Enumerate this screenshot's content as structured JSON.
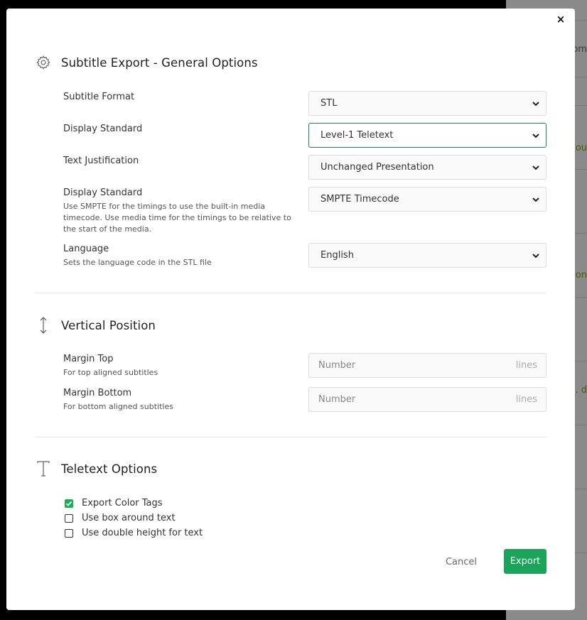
{
  "background": {
    "fragments": [
      "om",
      "you",
      "son",
      ". d"
    ]
  },
  "modal": {
    "close_label": "×"
  },
  "general": {
    "title": "Subtitle Export - General Options",
    "icon": "gear-icon",
    "subtitle_format": {
      "label": "Subtitle Format",
      "value": "STL"
    },
    "display_standard": {
      "label": "Display Standard",
      "value": "Level-1 Teletext"
    },
    "text_justification": {
      "label": "Text Justification",
      "value": "Unchanged Presentation"
    },
    "timecode": {
      "label": "Display Standard",
      "hint": "Use SMPTE for the timings to use the built-in media timecode. Use media time for the timings to be relative to the start of the media.",
      "value": "SMPTE Timecode"
    },
    "language": {
      "label": "Language",
      "hint": "Sets the language code in the STL file",
      "value": "English"
    }
  },
  "vertical": {
    "title": "Vertical Position",
    "icon": "vertical-arrows-icon",
    "margin_top": {
      "label": "Margin Top",
      "hint": "For top aligned subtitles",
      "placeholder": "Number",
      "unit": "lines"
    },
    "margin_bottom": {
      "label": "Margin Bottom",
      "hint": "For bottom aligned subtitles",
      "placeholder": "Number",
      "unit": "lines"
    }
  },
  "teletext": {
    "title": "Teletext Options",
    "icon": "text-t-icon",
    "options": [
      {
        "label": "Export Color Tags",
        "checked": true
      },
      {
        "label": "Use box around text",
        "checked": false
      },
      {
        "label": "Use double height for text",
        "checked": false
      }
    ]
  },
  "actions": {
    "cancel": "Cancel",
    "export": "Export"
  },
  "colors": {
    "accent": "#1aa45a",
    "checkbox": "#17b04f",
    "focus_border": "#1a8a4a"
  }
}
